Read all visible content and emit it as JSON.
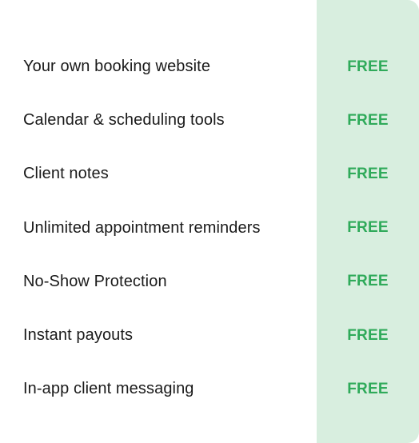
{
  "colors": {
    "highlight_column_bg": "#d8eedf",
    "price_text": "#2faa5a",
    "label_text": "#1a1a1a"
  },
  "features": [
    {
      "label": "Your own booking website",
      "price": "FREE"
    },
    {
      "label": "Calendar & scheduling tools",
      "price": "FREE"
    },
    {
      "label": "Client notes",
      "price": "FREE"
    },
    {
      "label": "Unlimited appointment reminders",
      "price": "FREE"
    },
    {
      "label": "No-Show Protection",
      "price": "FREE"
    },
    {
      "label": "Instant payouts",
      "price": "FREE"
    },
    {
      "label": "In-app client messaging",
      "price": "FREE"
    }
  ]
}
